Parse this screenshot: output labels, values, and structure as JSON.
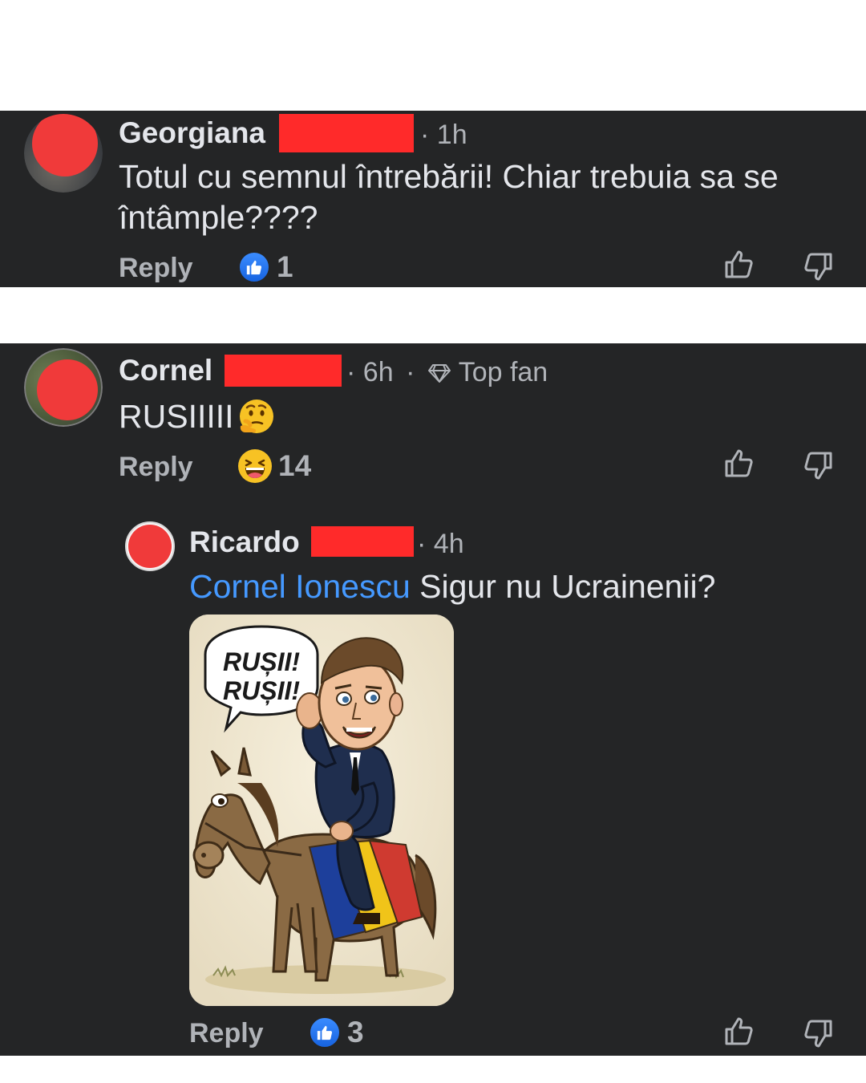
{
  "comments": [
    {
      "author": "Georgiana",
      "time": "1h",
      "text": "Totul cu semnul întrebării!  Chiar trebuia sa se întâmple????",
      "reply_label": "Reply",
      "reaction_icon": "like-icon",
      "reaction_count": "1"
    },
    {
      "author": "Cornel",
      "time": "6h",
      "badge": "Top fan",
      "text": "RUSIIIII",
      "text_emoji": "thinking-face",
      "reply_label": "Reply",
      "reaction_icon": "haha-icon",
      "reaction_count": "14",
      "replies": [
        {
          "author": "Ricardo",
          "time": "4h",
          "mention": "Cornel Ionescu",
          "text": " Sigur nu Ucrainenii?",
          "image": {
            "speech_bubble": [
              "RUȘII!",
              "RUȘII!"
            ]
          },
          "reply_label": "Reply",
          "reaction_icon": "like-icon",
          "reaction_count": "3"
        }
      ]
    }
  ],
  "colors": {
    "panel_bg": "#242526",
    "primary_text": "#e4e6eb",
    "secondary_text": "#b0b3b8",
    "mention": "#4599ff",
    "redaction": "#ff2a2a",
    "like_blue": "#1877f2"
  }
}
